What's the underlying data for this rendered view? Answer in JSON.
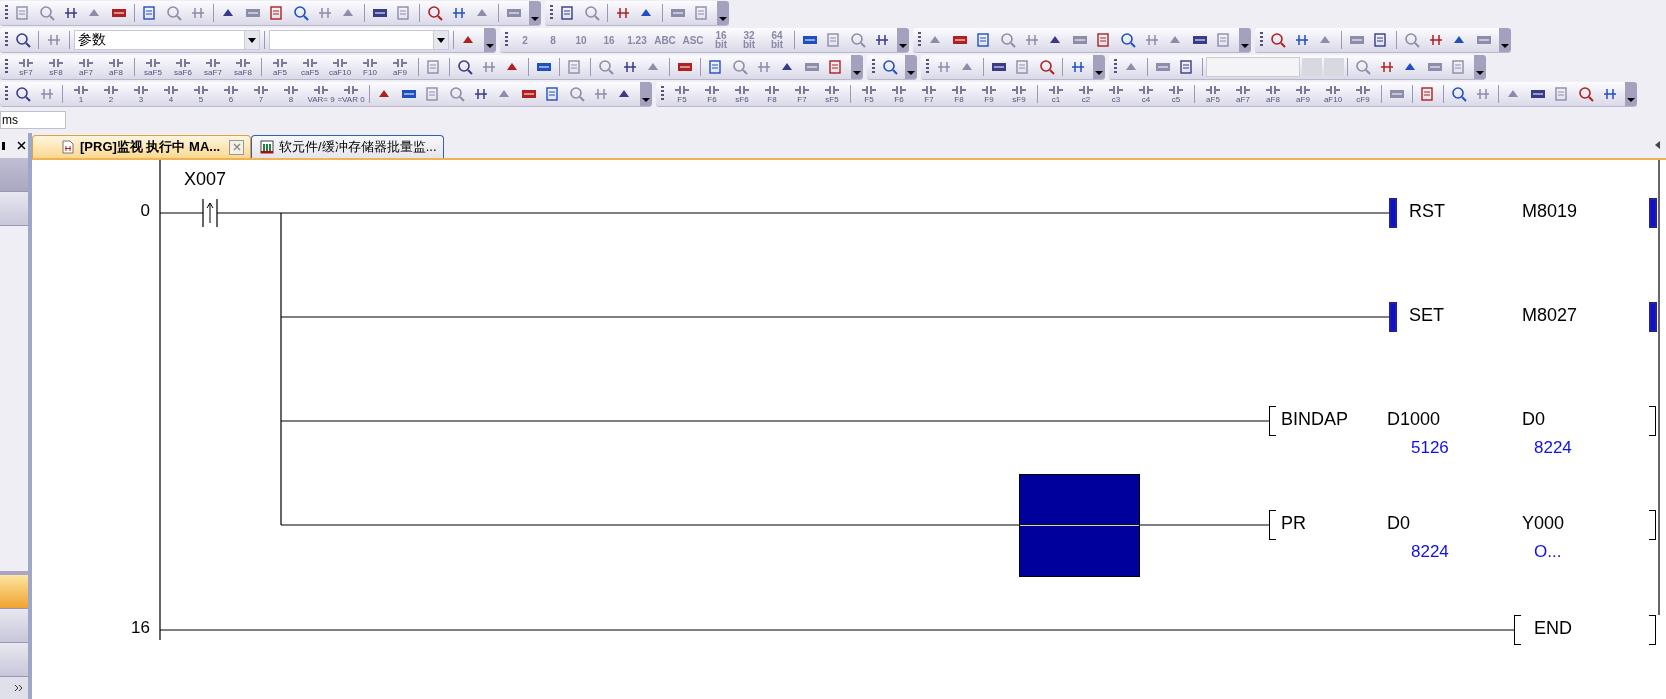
{
  "toolbar_groups": [
    {
      "kind": "text",
      "keys": [
        "2",
        "8",
        "10",
        "16",
        "1.23",
        "ABC",
        "ASC",
        "16 bit",
        "32 bit",
        "64 bit"
      ]
    },
    {
      "kind": "key",
      "keys": [
        "sF7",
        "sF8",
        "aF7",
        "aF8"
      ]
    },
    {
      "kind": "key",
      "keys": [
        "saF5",
        "saF6",
        "saF7",
        "saF8"
      ]
    },
    {
      "kind": "key",
      "keys": [
        "aF5",
        "caF5",
        "caF10",
        "F10",
        "aF9"
      ]
    },
    {
      "kind": "key",
      "keys": [
        "1",
        "2",
        "3",
        "4",
        "5",
        "6",
        "7",
        "8",
        "VAR= 9",
        "=VAR 0"
      ]
    },
    {
      "kind": "key",
      "keys": [
        "F5",
        "F6",
        "sF6",
        "F8",
        "F7",
        "sF5"
      ]
    },
    {
      "kind": "key",
      "keys": [
        "F5",
        "F6",
        "F7",
        "F8",
        "F9",
        "sF9"
      ]
    },
    {
      "kind": "key",
      "keys": [
        "c1",
        "c2",
        "c3",
        "c4",
        "c5"
      ]
    },
    {
      "kind": "key",
      "keys": [
        "aF5",
        "aF7",
        "aF8",
        "aF9",
        "aF10",
        "cF9"
      ]
    }
  ],
  "search_combo": {
    "value": "参数"
  },
  "side_field": {
    "value": "ms"
  },
  "tabs": [
    {
      "label": "[PRG]监视 执行中 MA...",
      "selected": true
    },
    {
      "label": "软元件/缓冲存储器批量监...",
      "selected": false
    }
  ],
  "ladder": {
    "rungs": [
      {
        "step": "0",
        "contact": {
          "device": "X007",
          "kind": "rising"
        },
        "outputs": [
          {
            "kind": "coil",
            "op": "RST",
            "on": true,
            "cursor": false,
            "operands": [
              {
                "device": "M8019"
              }
            ]
          },
          {
            "kind": "coil",
            "op": "SET",
            "on": true,
            "cursor": false,
            "operands": [
              {
                "device": "M8027"
              }
            ]
          },
          {
            "kind": "function",
            "op": "BINDAP",
            "on": false,
            "cursor": false,
            "operands": [
              {
                "device": "D1000",
                "value": "5126"
              },
              {
                "device": "D0",
                "value": "8224"
              }
            ]
          },
          {
            "kind": "function",
            "op": "PR",
            "on": false,
            "cursor": true,
            "operands": [
              {
                "device": "D0",
                "value": "8224"
              },
              {
                "device": "Y000",
                "value": "O..."
              }
            ]
          }
        ]
      },
      {
        "step": "16",
        "outputs": [
          {
            "kind": "end",
            "op": "END",
            "on": false,
            "cursor": false
          }
        ]
      }
    ]
  }
}
